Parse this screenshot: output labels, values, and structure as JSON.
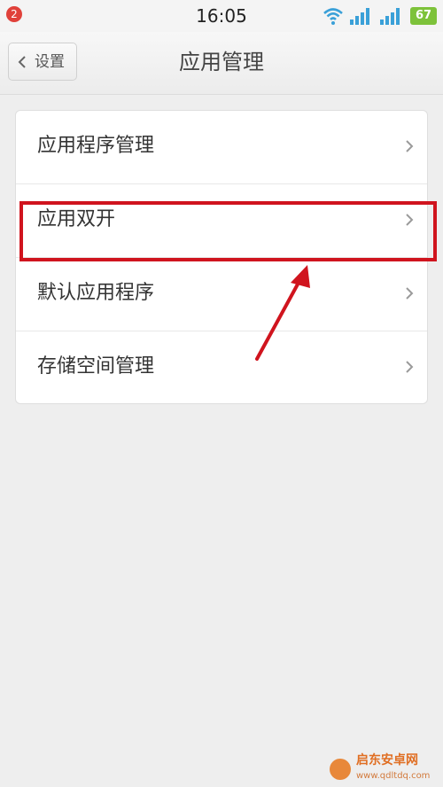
{
  "status_bar": {
    "notification_count": "2",
    "time": "16:05",
    "battery": "67",
    "icons": [
      "wifi-icon",
      "signal-icon",
      "signal-icon"
    ]
  },
  "header": {
    "back_label": "设置",
    "title": "应用管理"
  },
  "menu": {
    "items": [
      {
        "label": "应用程序管理"
      },
      {
        "label": "应用双开"
      },
      {
        "label": "默认应用程序"
      },
      {
        "label": "存储空间管理"
      }
    ]
  },
  "highlighted_item": "应用双开",
  "watermark": {
    "name": "启东安卓网",
    "url": "www.qdltdq.com"
  },
  "colors": {
    "annotation_red": "#d0141e",
    "battery_green": "#7dc23a",
    "badge_red": "#e0413a"
  }
}
